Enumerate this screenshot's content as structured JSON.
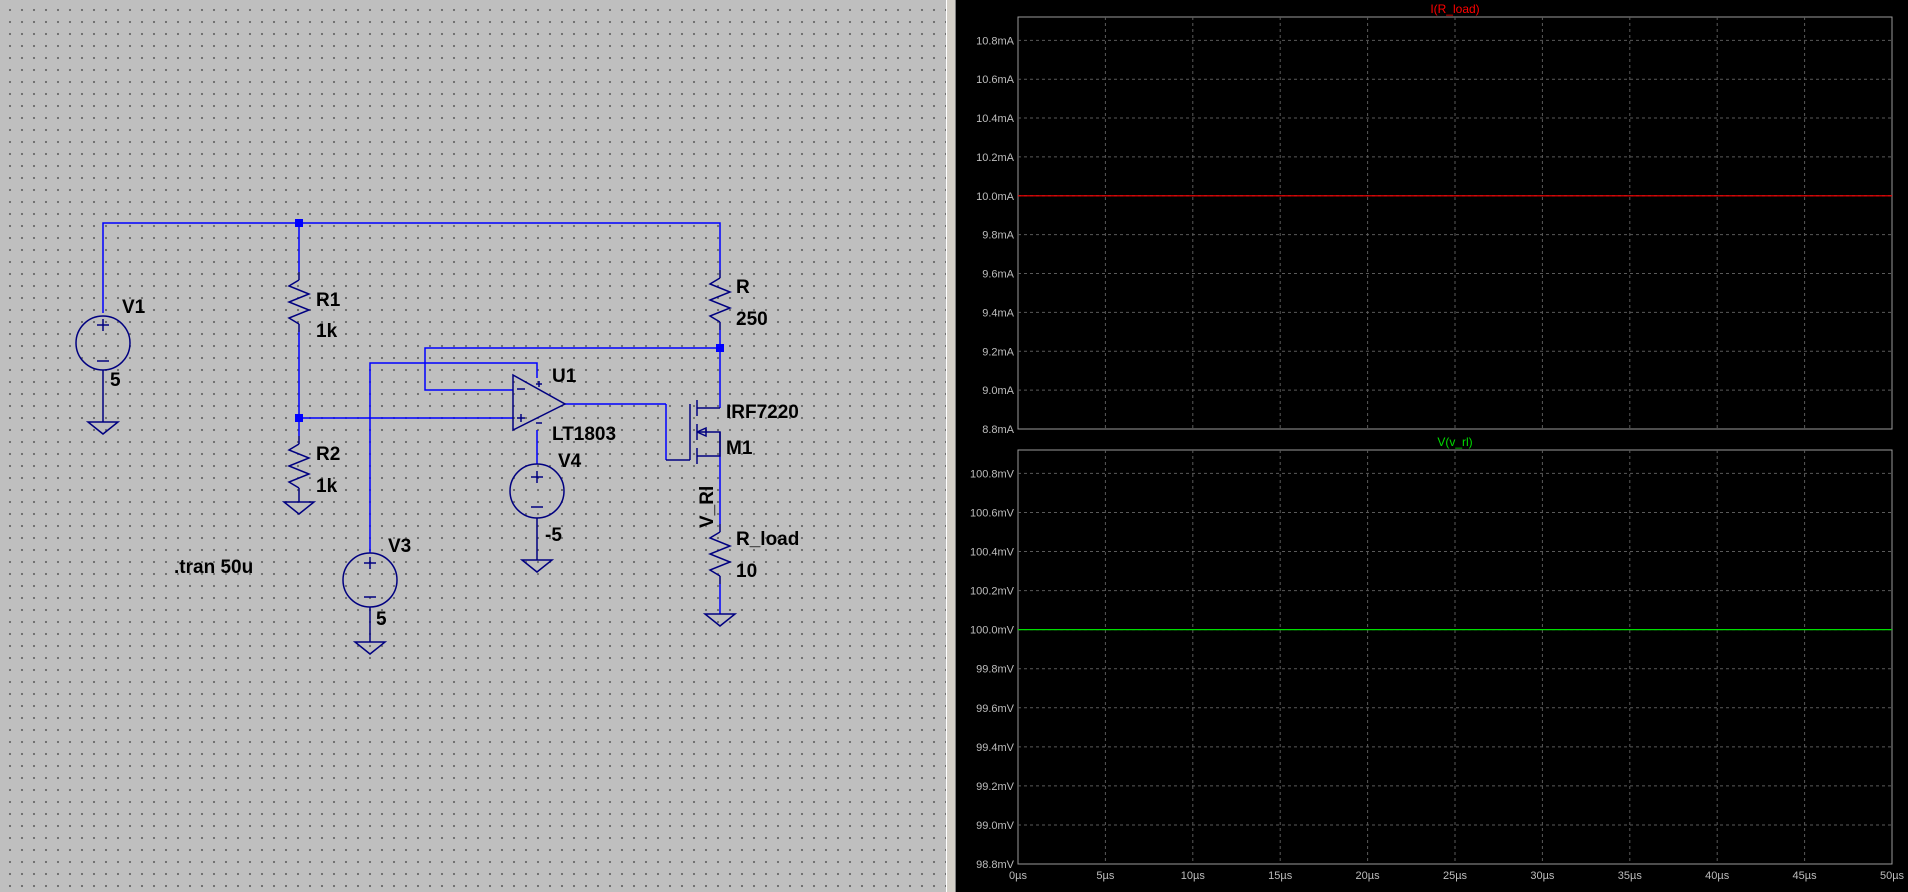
{
  "schematic": {
    "labels": {
      "v1_name": "V1",
      "v1_value": "5",
      "r1_name": "R1",
      "r1_value": "1k",
      "r2_name": "R2",
      "r2_value": "1k",
      "r_name": "R",
      "r_value": "250",
      "u1_name": "U1",
      "u1_model": "LT1803",
      "v4_name": "V4",
      "v4_value": "-5",
      "m1_model": "IRF7220",
      "m1_name": "M1",
      "net_label": "V_Rl",
      "rload_name": "R_load",
      "rload_value": "10",
      "v3_name": "V3",
      "v3_value": "5",
      "directive": ".tran 50u"
    },
    "colors": {
      "wire": "#0000ff",
      "component": "#000080",
      "background": "#bfbfbf"
    }
  },
  "waveform": {
    "x_ticks": [
      "0µs",
      "5µs",
      "10µs",
      "15µs",
      "20µs",
      "25µs",
      "30µs",
      "35µs",
      "40µs",
      "45µs",
      "50µs"
    ],
    "panes": [
      {
        "title": "I(R_load)",
        "color": "#ff0000",
        "unit": "mA",
        "y_ticks": [
          "10.8mA",
          "10.6mA",
          "10.4mA",
          "10.2mA",
          "10.0mA",
          "9.8mA",
          "9.6mA",
          "9.4mA",
          "9.2mA",
          "9.0mA",
          "8.8mA"
        ],
        "y_range": [
          8.8,
          10.8
        ],
        "trace_value": 10.0
      },
      {
        "title": "V(v_rl)",
        "color": "#00dd00",
        "unit": "mV",
        "y_ticks": [
          "100.8mV",
          "100.6mV",
          "100.4mV",
          "100.2mV",
          "100.0mV",
          "99.8mV",
          "99.6mV",
          "99.4mV",
          "99.2mV",
          "99.0mV",
          "98.8mV"
        ],
        "y_range": [
          98.8,
          100.8
        ],
        "trace_value": 100.0
      }
    ],
    "chart_data": [
      {
        "type": "line",
        "title": "I(R_load)",
        "x": [
          0,
          50
        ],
        "xlim": [
          0,
          50
        ],
        "ylim": [
          8.8,
          10.8
        ],
        "series": [
          {
            "name": "I(R_load)",
            "values": [
              10.0,
              10.0
            ]
          }
        ]
      },
      {
        "type": "line",
        "title": "V(v_rl)",
        "x": [
          0,
          50
        ],
        "xlim": [
          0,
          50
        ],
        "ylim": [
          98.8,
          100.8
        ],
        "series": [
          {
            "name": "V(v_rl)",
            "values": [
              100.0,
              100.0
            ]
          }
        ]
      }
    ]
  }
}
